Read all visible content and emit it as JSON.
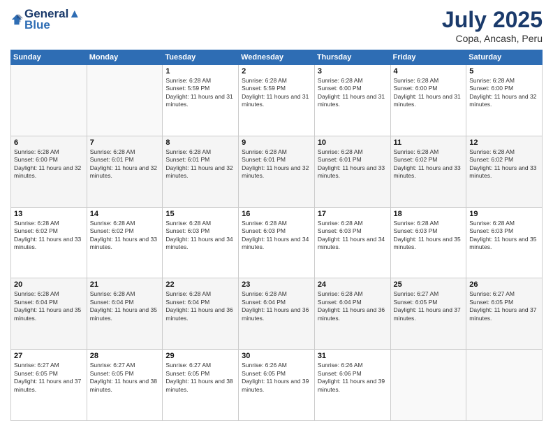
{
  "logo": {
    "line1": "General",
    "line2": "Blue"
  },
  "title": "July 2025",
  "subtitle": "Copa, Ancash, Peru",
  "days_header": [
    "Sunday",
    "Monday",
    "Tuesday",
    "Wednesday",
    "Thursday",
    "Friday",
    "Saturday"
  ],
  "weeks": [
    [
      {
        "day": "",
        "info": ""
      },
      {
        "day": "",
        "info": ""
      },
      {
        "day": "1",
        "sunrise": "6:28 AM",
        "sunset": "5:59 PM",
        "daylight": "11 hours and 31 minutes."
      },
      {
        "day": "2",
        "sunrise": "6:28 AM",
        "sunset": "5:59 PM",
        "daylight": "11 hours and 31 minutes."
      },
      {
        "day": "3",
        "sunrise": "6:28 AM",
        "sunset": "6:00 PM",
        "daylight": "11 hours and 31 minutes."
      },
      {
        "day": "4",
        "sunrise": "6:28 AM",
        "sunset": "6:00 PM",
        "daylight": "11 hours and 31 minutes."
      },
      {
        "day": "5",
        "sunrise": "6:28 AM",
        "sunset": "6:00 PM",
        "daylight": "11 hours and 32 minutes."
      }
    ],
    [
      {
        "day": "6",
        "sunrise": "6:28 AM",
        "sunset": "6:00 PM",
        "daylight": "11 hours and 32 minutes."
      },
      {
        "day": "7",
        "sunrise": "6:28 AM",
        "sunset": "6:01 PM",
        "daylight": "11 hours and 32 minutes."
      },
      {
        "day": "8",
        "sunrise": "6:28 AM",
        "sunset": "6:01 PM",
        "daylight": "11 hours and 32 minutes."
      },
      {
        "day": "9",
        "sunrise": "6:28 AM",
        "sunset": "6:01 PM",
        "daylight": "11 hours and 32 minutes."
      },
      {
        "day": "10",
        "sunrise": "6:28 AM",
        "sunset": "6:01 PM",
        "daylight": "11 hours and 33 minutes."
      },
      {
        "day": "11",
        "sunrise": "6:28 AM",
        "sunset": "6:02 PM",
        "daylight": "11 hours and 33 minutes."
      },
      {
        "day": "12",
        "sunrise": "6:28 AM",
        "sunset": "6:02 PM",
        "daylight": "11 hours and 33 minutes."
      }
    ],
    [
      {
        "day": "13",
        "sunrise": "6:28 AM",
        "sunset": "6:02 PM",
        "daylight": "11 hours and 33 minutes."
      },
      {
        "day": "14",
        "sunrise": "6:28 AM",
        "sunset": "6:02 PM",
        "daylight": "11 hours and 33 minutes."
      },
      {
        "day": "15",
        "sunrise": "6:28 AM",
        "sunset": "6:03 PM",
        "daylight": "11 hours and 34 minutes."
      },
      {
        "day": "16",
        "sunrise": "6:28 AM",
        "sunset": "6:03 PM",
        "daylight": "11 hours and 34 minutes."
      },
      {
        "day": "17",
        "sunrise": "6:28 AM",
        "sunset": "6:03 PM",
        "daylight": "11 hours and 34 minutes."
      },
      {
        "day": "18",
        "sunrise": "6:28 AM",
        "sunset": "6:03 PM",
        "daylight": "11 hours and 35 minutes."
      },
      {
        "day": "19",
        "sunrise": "6:28 AM",
        "sunset": "6:03 PM",
        "daylight": "11 hours and 35 minutes."
      }
    ],
    [
      {
        "day": "20",
        "sunrise": "6:28 AM",
        "sunset": "6:04 PM",
        "daylight": "11 hours and 35 minutes."
      },
      {
        "day": "21",
        "sunrise": "6:28 AM",
        "sunset": "6:04 PM",
        "daylight": "11 hours and 35 minutes."
      },
      {
        "day": "22",
        "sunrise": "6:28 AM",
        "sunset": "6:04 PM",
        "daylight": "11 hours and 36 minutes."
      },
      {
        "day": "23",
        "sunrise": "6:28 AM",
        "sunset": "6:04 PM",
        "daylight": "11 hours and 36 minutes."
      },
      {
        "day": "24",
        "sunrise": "6:28 AM",
        "sunset": "6:04 PM",
        "daylight": "11 hours and 36 minutes."
      },
      {
        "day": "25",
        "sunrise": "6:27 AM",
        "sunset": "6:05 PM",
        "daylight": "11 hours and 37 minutes."
      },
      {
        "day": "26",
        "sunrise": "6:27 AM",
        "sunset": "6:05 PM",
        "daylight": "11 hours and 37 minutes."
      }
    ],
    [
      {
        "day": "27",
        "sunrise": "6:27 AM",
        "sunset": "6:05 PM",
        "daylight": "11 hours and 37 minutes."
      },
      {
        "day": "28",
        "sunrise": "6:27 AM",
        "sunset": "6:05 PM",
        "daylight": "11 hours and 38 minutes."
      },
      {
        "day": "29",
        "sunrise": "6:27 AM",
        "sunset": "6:05 PM",
        "daylight": "11 hours and 38 minutes."
      },
      {
        "day": "30",
        "sunrise": "6:26 AM",
        "sunset": "6:05 PM",
        "daylight": "11 hours and 39 minutes."
      },
      {
        "day": "31",
        "sunrise": "6:26 AM",
        "sunset": "6:06 PM",
        "daylight": "11 hours and 39 minutes."
      },
      {
        "day": "",
        "info": ""
      },
      {
        "day": "",
        "info": ""
      }
    ]
  ]
}
